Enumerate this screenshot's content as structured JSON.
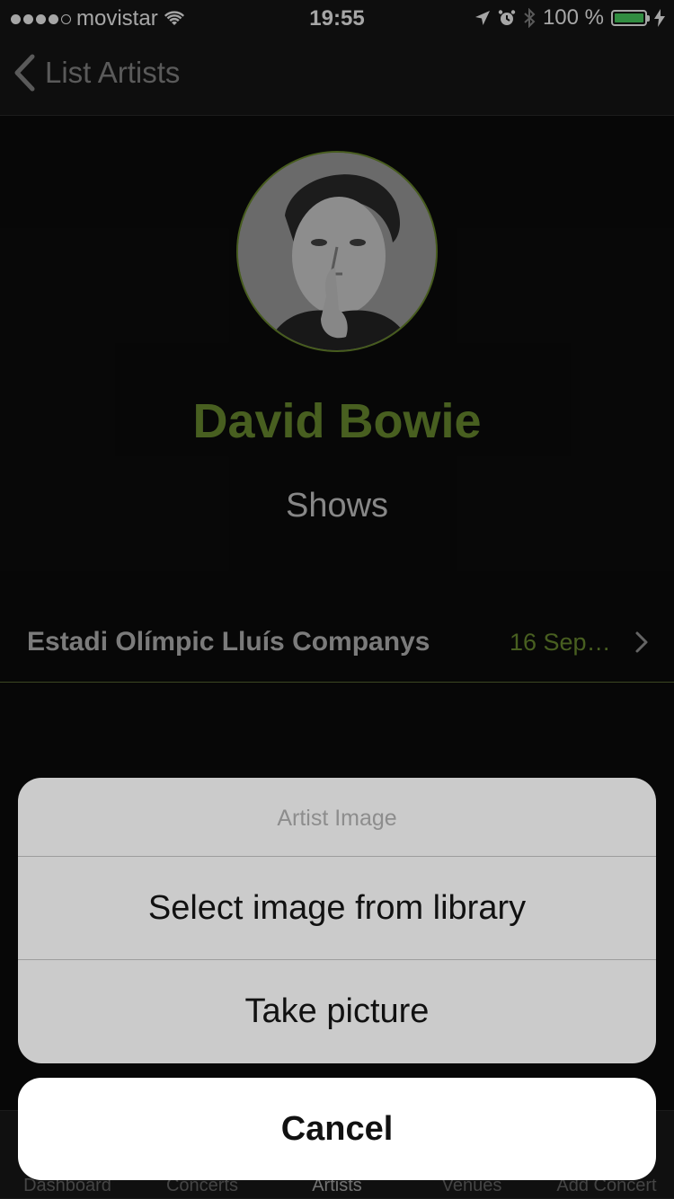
{
  "status_bar": {
    "carrier": "movistar",
    "time": "19:55",
    "battery_text": "100 %",
    "battery_level": 1.0,
    "battery_color": "#4cd964",
    "icons": [
      "signal-dots-icon",
      "wifi-icon",
      "location-arrow-icon",
      "alarm-icon",
      "bluetooth-icon",
      "battery-icon",
      "charging-bolt-icon"
    ]
  },
  "nav": {
    "back_label": "List Artists",
    "back_icon": "chevron-left-icon"
  },
  "artist": {
    "name": "David Bowie",
    "avatar_description_icon": "artist-photo",
    "accent_color": "#6f9232"
  },
  "shows": {
    "section_title": "Shows",
    "items": [
      {
        "venue": "Estadi Olímpic Lluís Companys",
        "date": "16 Sep…"
      }
    ]
  },
  "action_sheet": {
    "title": "Artist Image",
    "buttons": [
      "Select image from library",
      "Take picture"
    ],
    "cancel_label": "Cancel"
  },
  "tab_bar": {
    "items": [
      "Dashboard",
      "Concerts",
      "Artists",
      "Venues",
      "Add Concert"
    ],
    "selected": "Artists"
  }
}
